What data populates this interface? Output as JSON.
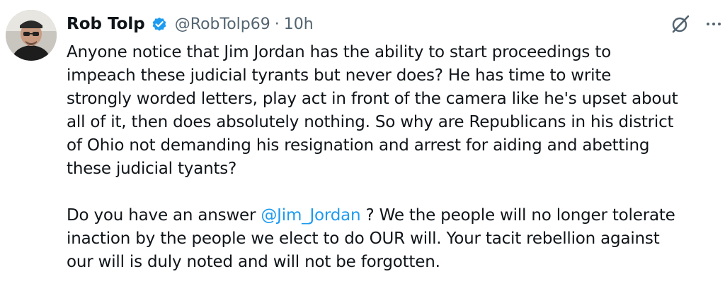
{
  "author": {
    "display_name": "Rob Tolp",
    "handle": "@RobTolp69",
    "separator": "·",
    "time": "10h"
  },
  "icons": {
    "avatar": "avatar-photo",
    "verified": "verified-badge-icon",
    "grok": "grok-icon",
    "more": "more-options-icon"
  },
  "colors": {
    "verified": "#1d9bf0",
    "mention": "#1d9bf0",
    "secondary_text": "#536471"
  },
  "post": {
    "paragraph1": [
      "Anyone notice that Jim Jordan has the ability to start proceedings to",
      "impeach these judicial tyrants but never does? He has time to write",
      "strongly worded letters, play act in front of the camera like he's upset about",
      "all of it, then does absolutely nothing. So why are Republicans in his district",
      "of Ohio not demanding his resignation and arrest for aiding and abetting",
      "these judicial tyants?"
    ],
    "paragraph2": {
      "before_mention": "Do you have an answer ",
      "mention": "@Jim_Jordan",
      "after_mention": " ? We the people will no longer tolerate",
      "line2": "inaction by the people we elect to do OUR will. Your tacit rebellion against",
      "line3": "our will is duly noted and will not be forgotten."
    }
  }
}
